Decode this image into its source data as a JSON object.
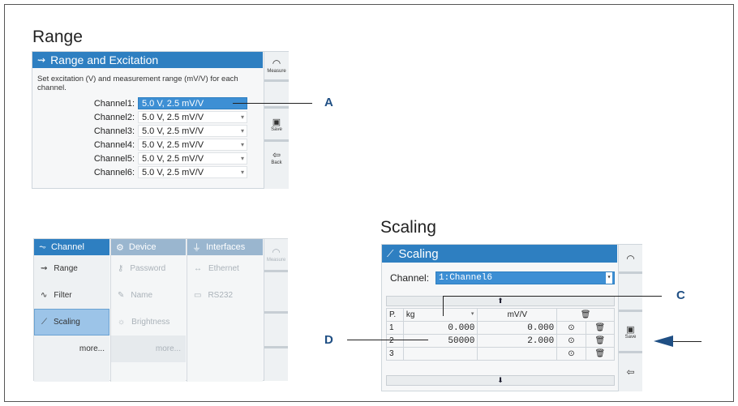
{
  "range": {
    "section_title": "Range",
    "header": "Range and Excitation",
    "description": "Set excitation (V) and measurement range (mV/V) for each channel.",
    "channels": [
      {
        "label": "Channel1:",
        "value": "5.0 V,  2.5 mV/V"
      },
      {
        "label": "Channel2:",
        "value": "5.0 V,  2.5 mV/V"
      },
      {
        "label": "Channel3:",
        "value": "5.0 V,  2.5 mV/V"
      },
      {
        "label": "Channel4:",
        "value": "5.0 V,  2.5 mV/V"
      },
      {
        "label": "Channel5:",
        "value": "5.0 V,  2.5 mV/V"
      },
      {
        "label": "Channel6:",
        "value": "5.0 V,  2.5 mV/V"
      }
    ],
    "side": {
      "measure": "Measure",
      "save": "Save",
      "back": "Back"
    }
  },
  "menu": {
    "channel_tab": "Channel",
    "device_tab": "Device",
    "interfaces_tab": "Interfaces",
    "channel_items": [
      "Range",
      "Filter",
      "Scaling"
    ],
    "channel_more": "more...",
    "device_items": [
      "Password",
      "Name",
      "Brightness"
    ],
    "device_more": "more...",
    "interface_items": [
      "Ethernet",
      "RS232"
    ],
    "measure": "Measure"
  },
  "scaling": {
    "section_title": "Scaling",
    "header": "Scaling",
    "channel_label": "Channel:",
    "channel_value": "1:Channel6",
    "col_p": "P.",
    "unit_left": "kg",
    "unit_right": "mV/V",
    "rows": [
      {
        "p": "1",
        "left": "0.000",
        "right": "0.000"
      },
      {
        "p": "2",
        "left": "50000",
        "right": "2.000"
      },
      {
        "p": "3",
        "left": "",
        "right": ""
      }
    ],
    "save": "Save"
  },
  "callouts": {
    "a": "A",
    "c": "C",
    "d": "D"
  },
  "colors": {
    "accent": "#2e7fc1",
    "selection": "#3d8fd4",
    "callout": "#1f4f84"
  }
}
